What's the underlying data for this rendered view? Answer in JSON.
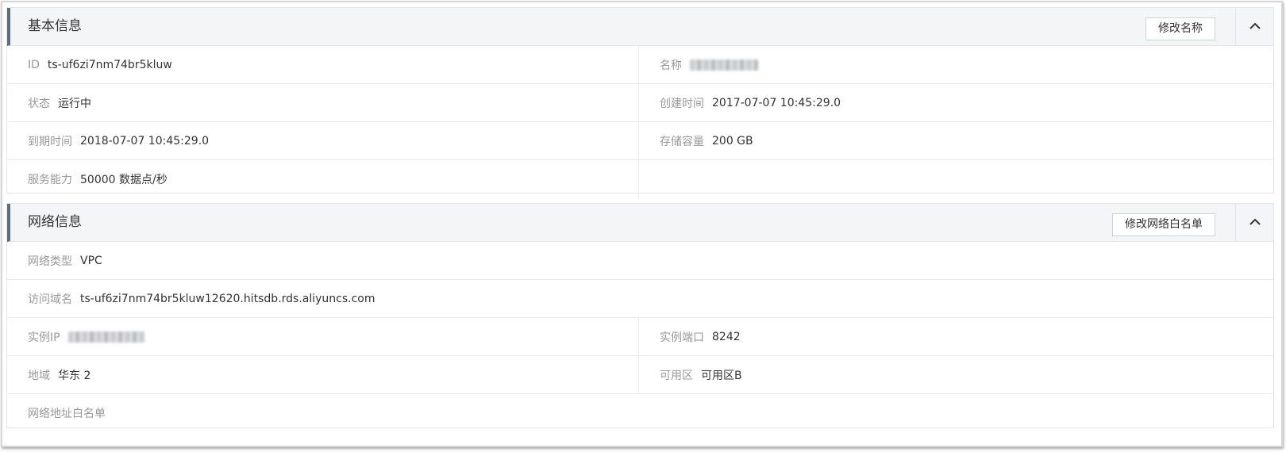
{
  "basic_info": {
    "title": "基本信息",
    "edit_button": "修改名称",
    "fields": {
      "id_label": "ID",
      "id_value": "ts-uf6zi7nm74br5kluw",
      "name_label": "名称",
      "status_label": "状态",
      "status_value": "运行中",
      "created_label": "创建时间",
      "created_value": "2017-07-07 10:45:29.0",
      "expire_label": "到期时间",
      "expire_value": "2018-07-07 10:45:29.0",
      "storage_label": "存储容量",
      "storage_value": "200 GB",
      "capacity_label": "服务能力",
      "capacity_value": "50000 数据点/秒"
    }
  },
  "network_info": {
    "title": "网络信息",
    "edit_button": "修改网络白名单",
    "fields": {
      "net_type_label": "网络类型",
      "net_type_value": "VPC",
      "domain_label": "访问域名",
      "domain_value": "ts-uf6zi7nm74br5kluw12620.hitsdb.rds.aliyuncs.com",
      "ip_label": "实例IP",
      "port_label": "实例端口",
      "port_value": "8242",
      "region_label": "地域",
      "region_value": "华东 2",
      "zone_label": "可用区",
      "zone_value": "可用区B",
      "whitelist_label": "网络地址白名单"
    }
  },
  "colors": {
    "header_bg": "#f4f5f7",
    "header_accent": "#5f6d7a",
    "label": "#999999",
    "value": "#333333",
    "border": "#e3e5e8"
  },
  "icons": {
    "collapse": "chevron-up-icon"
  }
}
